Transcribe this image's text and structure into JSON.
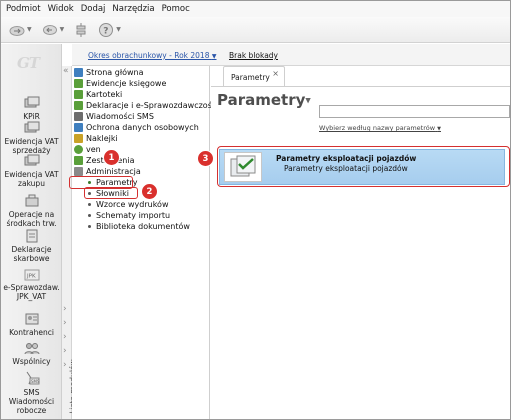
{
  "menubar": {
    "items": [
      "Podmiot",
      "Widok",
      "Dodaj",
      "Narzędzia",
      "Pomoc"
    ]
  },
  "toolbar": {
    "buttons": [
      "cloud-arrow-icon",
      "database-arrow-icon",
      "sync-icon",
      "help-icon"
    ]
  },
  "leftnav": {
    "logo": "GT",
    "items": [
      {
        "label": "KPiR",
        "icon": "books-icon"
      },
      {
        "label": "Ewidencja VAT sprzedaży",
        "icon": "books-icon"
      },
      {
        "label": "Ewidencja VAT zakupu",
        "icon": "books-icon"
      },
      {
        "label": "Operacje na środkach trw.",
        "icon": "assets-icon"
      },
      {
        "label": "Deklaracje skarbowe",
        "icon": "declaration-icon"
      },
      {
        "label": "e-Sprawozdaw. JPK_VAT",
        "icon": "jpk-icon"
      },
      {
        "label": "Kontrahenci",
        "icon": "contacts-icon"
      },
      {
        "label": "Wspólnicy",
        "icon": "partners-icon"
      },
      {
        "label": "SMS Wiadomości robocze",
        "icon": "sms-icon"
      }
    ],
    "collapse_label": "Lista modułów"
  },
  "infobar": {
    "period": "Okres obrachunkowy - Rok 2018",
    "lock_status": "Brak blokady"
  },
  "tree": {
    "items": [
      {
        "label": "Strona główna",
        "color": "#3f7fbf"
      },
      {
        "label": "Ewidencje księgowe",
        "color": "#5a9f3a"
      },
      {
        "label": "Kartoteki",
        "color": "#5a9f3a"
      },
      {
        "label": "Deklaracje i e-Sprawozdawczość",
        "color": "#5a9f3a"
      },
      {
        "label": "Wiadomości SMS",
        "color": "#6d6d6d"
      },
      {
        "label": "Ochrona danych osobowych",
        "color": "#3f7fbf"
      },
      {
        "label": "Naklejki",
        "color": "#c9a227"
      },
      {
        "label": "ven",
        "color": "#5a9f3a"
      },
      {
        "label": "Zestawienia",
        "color": "#5a9f3a"
      },
      {
        "label": "Administracja",
        "color": "#8a8a8a"
      }
    ],
    "sub_items": [
      "Parametry",
      "Słowniki",
      "Wzorce wydruków",
      "Schematy importu",
      "Biblioteka dokumentów"
    ]
  },
  "content": {
    "tab_label": "Parametry",
    "tab_close": "×",
    "title": "Parametry",
    "search_value": "",
    "search_hint": "Wybierz według nazwy parametrów",
    "card": {
      "title": "Parametry eksploatacji pojazdów",
      "subtitle": "Parametry eksploatacji pojazdów"
    }
  },
  "annotations": {
    "badges": [
      "1",
      "2",
      "3"
    ],
    "color": "#d9302d"
  }
}
